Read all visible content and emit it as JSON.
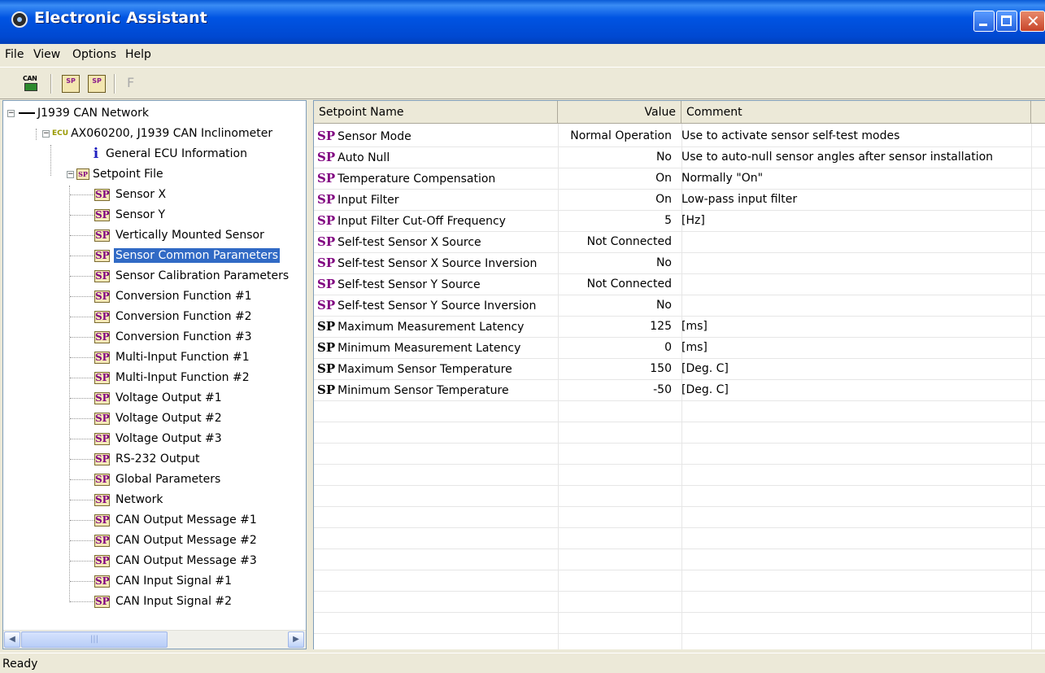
{
  "window": {
    "title": "Electronic Assistant"
  },
  "menu": [
    "File",
    "View",
    "Options",
    "Help"
  ],
  "toolbar": {
    "can_label": "CAN",
    "sp1_label": "SP",
    "sp2_label": "SP",
    "f_label": "F"
  },
  "tree": {
    "network": "J1939 CAN Network",
    "ecu_tag": "ECU",
    "ecu": "AX060200, J1939 CAN Inclinometer",
    "general_info": "General ECU Information",
    "setpoint_file": "Setpoint File",
    "sp_icon_text": "SP",
    "info_icon_text": "i",
    "items": [
      "Sensor X",
      "Sensor Y",
      "Vertically Mounted Sensor",
      "Sensor Common Parameters",
      "Sensor Calibration Parameters",
      "Conversion Function #1",
      "Conversion Function #2",
      "Conversion Function #3",
      "Multi-Input Function #1",
      "Multi-Input Function #2",
      "Voltage Output #1",
      "Voltage Output #2",
      "Voltage Output #3",
      "RS-232 Output",
      "Global Parameters",
      "Network",
      "CAN Output Message #1",
      "CAN Output Message #2",
      "CAN Output Message #3",
      "CAN Input Signal #1",
      "CAN Input Signal #2"
    ],
    "selected_index": 3
  },
  "table": {
    "headers": {
      "name": "Setpoint Name",
      "value": "Value",
      "comment": "Comment"
    },
    "sp_mark": "SP",
    "rows": [
      {
        "name": "Sensor Mode",
        "value": "Normal Operation",
        "comment": "Use to activate sensor self-test modes",
        "mark_color": "#800080"
      },
      {
        "name": "Auto Null",
        "value": "No",
        "comment": "Use to auto-null sensor angles after sensor installation",
        "mark_color": "#800080"
      },
      {
        "name": "Temperature Compensation",
        "value": "On",
        "comment": "Normally \"On\"",
        "mark_color": "#800080"
      },
      {
        "name": "Input Filter",
        "value": "On",
        "comment": "Low-pass input filter",
        "mark_color": "#800080"
      },
      {
        "name": "Input Filter Cut-Off Frequency",
        "value": "5",
        "comment": "[Hz]",
        "mark_color": "#800080"
      },
      {
        "name": "Self-test Sensor X Source",
        "value": "Not Connected",
        "comment": "",
        "mark_color": "#800080"
      },
      {
        "name": "Self-test Sensor X Source Inversion",
        "value": "No",
        "comment": "",
        "mark_color": "#800080"
      },
      {
        "name": "Self-test Sensor Y Source",
        "value": "Not Connected",
        "comment": "",
        "mark_color": "#800080"
      },
      {
        "name": "Self-test Sensor Y Source Inversion",
        "value": "No",
        "comment": "",
        "mark_color": "#800080"
      },
      {
        "name": "Maximum Measurement Latency",
        "value": "125",
        "comment": "[ms]",
        "mark_color": "#000000"
      },
      {
        "name": "Minimum Measurement Latency",
        "value": "0",
        "comment": "[ms]",
        "mark_color": "#000000"
      },
      {
        "name": "Maximum Sensor Temperature",
        "value": "150",
        "comment": "[Deg. C]",
        "mark_color": "#000000"
      },
      {
        "name": "Minimum Sensor Temperature",
        "value": "-50",
        "comment": "[Deg. C]",
        "mark_color": "#000000"
      }
    ]
  },
  "status": {
    "text": "Ready"
  },
  "colors": {
    "titlebar": "#0054E3",
    "selection": "#316AC5",
    "sp_purple": "#800080"
  }
}
